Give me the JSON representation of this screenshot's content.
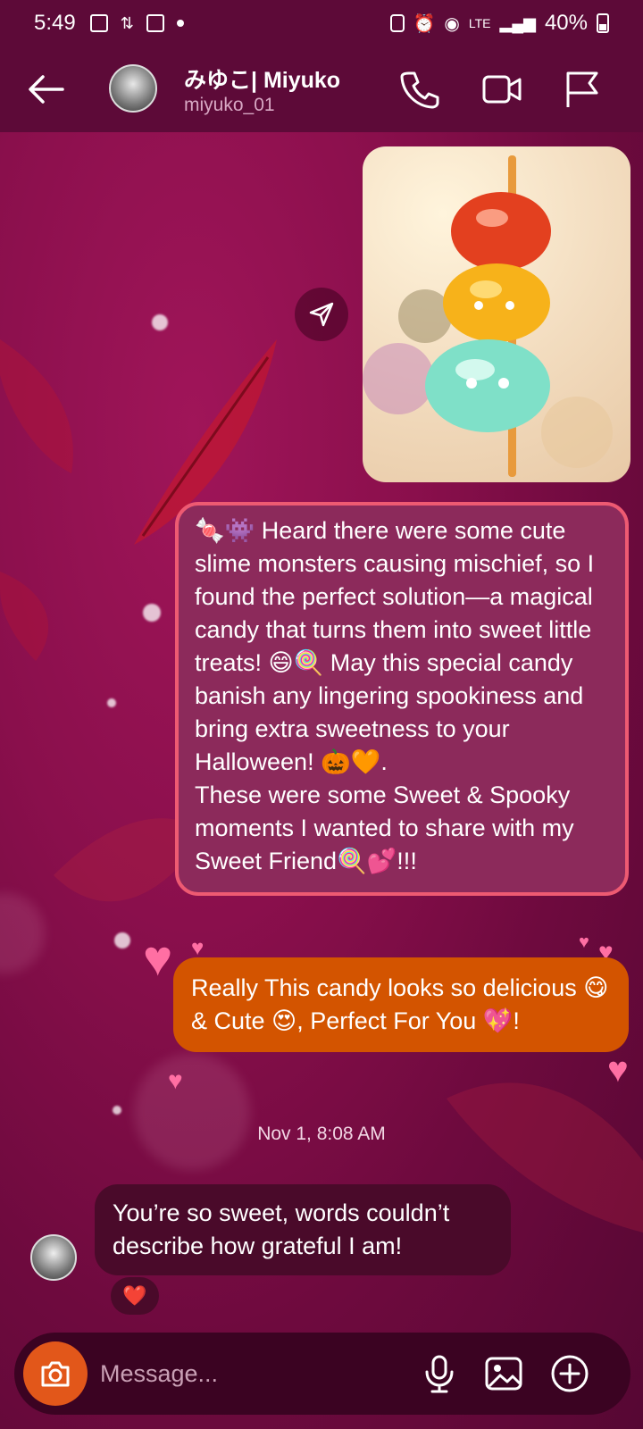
{
  "status_bar": {
    "time": "5:49",
    "network": "LTE",
    "battery": "40%"
  },
  "header": {
    "name": "みゆこ| Miyuko",
    "username": "miyuko_01",
    "icons": [
      "back-arrow-icon",
      "phone-icon",
      "video-icon",
      "flag-icon"
    ]
  },
  "messages": {
    "sent_1": "🍬👾 Heard there were some cute slime monsters causing mischief, so I found the perfect solution—a magical candy that turns them into sweet little treats! 😄🍭 May this special candy banish any lingering spookiness and bring extra sweetness to your Halloween! 🎃🧡.",
    "sent_1_line2": "These were some Sweet & Spooky moments I wanted to share with my Sweet Friend🍭💕!!!",
    "sent_2": "Really This candy looks so delicious 😋 & Cute 😍, Perfect For You 💖!",
    "timestamp": "Nov 1, 8:08 AM",
    "received_1": "You’re so sweet, words couldn’t describe how grateful I am!",
    "reaction": "❤️"
  },
  "composer": {
    "placeholder": "Message..."
  },
  "colors": {
    "header_bg": "#5d0a38",
    "sent_bubble": "#8c2a5b",
    "sent_bubble_border": "#ee5a72",
    "orange_bubble": "#d35400",
    "received_bubble": "#4a0a2a",
    "camera_button": "#e2571a"
  }
}
